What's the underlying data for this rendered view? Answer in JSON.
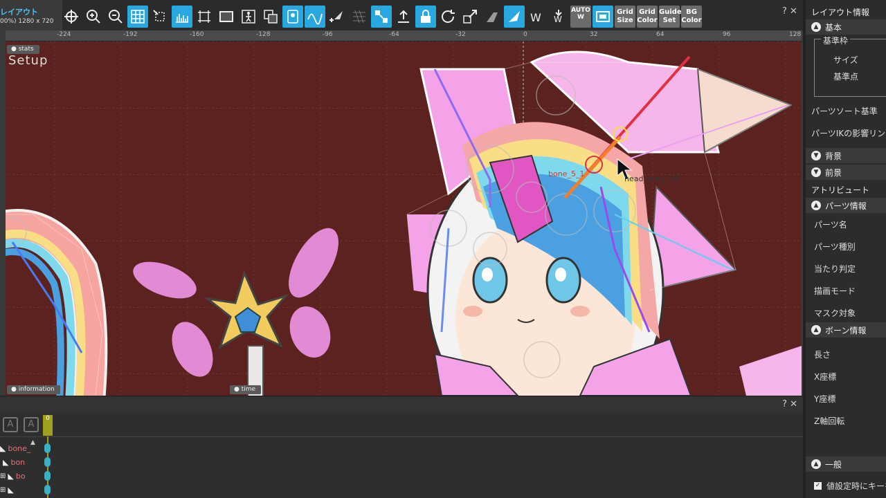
{
  "tab": {
    "title": "レイアウト",
    "subtitle": "00%) 1280 x 720"
  },
  "toolbar": {
    "auto_label": "AUTO",
    "grid_size": "Grid Size",
    "grid_color": "Grid Color",
    "guide_set": "Guide Set",
    "bg_color": "BG Color"
  },
  "ruler": {
    "ticks": [
      "-224",
      "-192",
      "-160",
      "-128",
      "-96",
      "-64",
      "-32",
      "0",
      "32",
      "64",
      "96",
      "128"
    ]
  },
  "canvas": {
    "stats_chip": "stats",
    "setup_label": "Setup",
    "info_chip": "information",
    "time_chip": "time",
    "bone_label": "bone_5_1",
    "part_label": "head_wing_04"
  },
  "timeline": {
    "frame_marker": "0",
    "rows": [
      "bone_",
      "bon",
      "bo",
      ""
    ],
    "close": "? ✕"
  },
  "right_panel": {
    "title": "レイアウト情報",
    "controls": "? ✕",
    "sections": {
      "basic": "基本",
      "frame_group": "基準枠",
      "size": "サイズ",
      "origin": "基準点",
      "part_sort": "パーツソート基準",
      "part_ik": "パーツIKの影響リンク",
      "background": "背景",
      "foreground": "前景",
      "attribute": "アトリビュート",
      "part_info": "パーツ情報",
      "part_name": "パーツ名",
      "part_type": "パーツ種別",
      "hit_detect": "当たり判定",
      "draw_mode": "描画モード",
      "mask_target": "マスク対象",
      "bone_info": "ボーン情報",
      "length": "長さ",
      "x_coord": "X座標",
      "y_coord": "Y座標",
      "z_rot": "Z軸回転",
      "general": "一般",
      "set_key": "値設定時にキーを"
    }
  },
  "colors": {
    "canvas_bg": "#5b2220",
    "accent": "#29a8e0",
    "panel": "#2c2c2c"
  }
}
